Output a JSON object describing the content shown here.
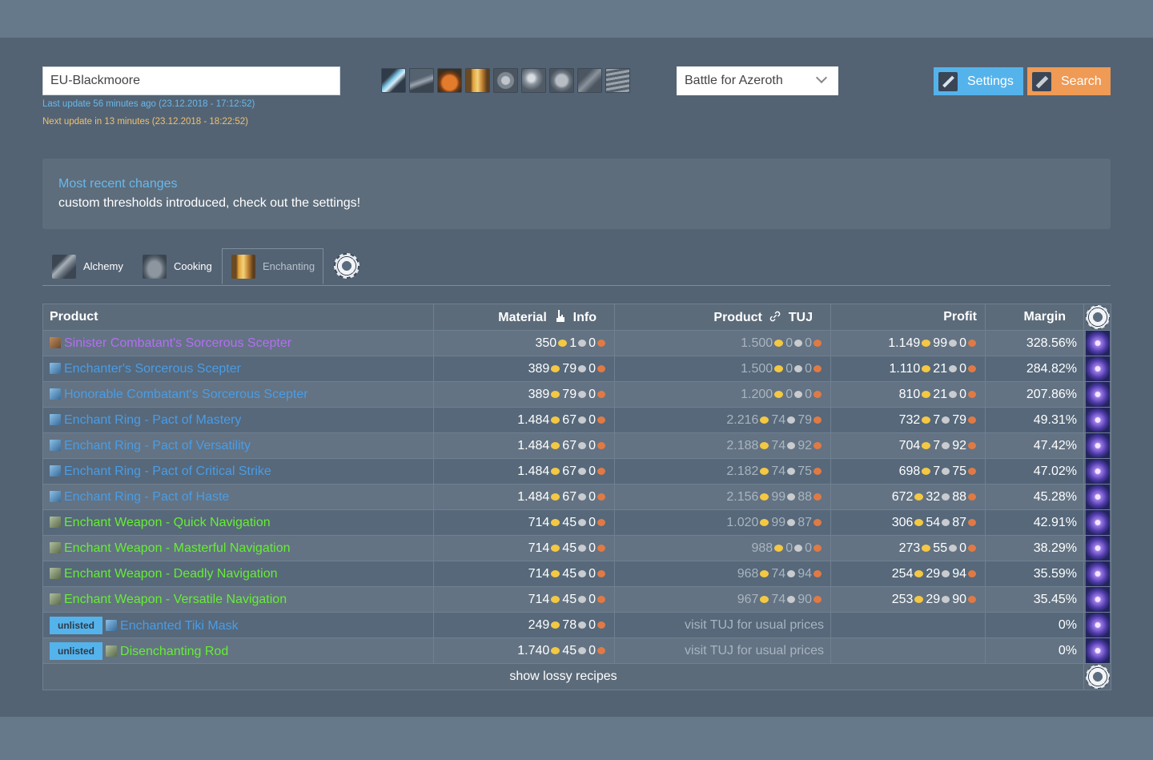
{
  "realm": {
    "value": "EU-Blackmoore"
  },
  "updates": {
    "last": "Last update 56 minutes ago (23.12.2018 - 17:12:52)",
    "next": "Next update in 13 minutes (23.12.2018 - 18:22:52)"
  },
  "profession_icons": [
    "alchemy-icon",
    "blacksmithing-icon",
    "cooking-icon",
    "enchanting-icon",
    "engineering-icon",
    "inscription-icon",
    "jewelcrafting-icon",
    "leatherworking-icon",
    "tailoring-icon"
  ],
  "expansion": {
    "selected": "Battle for Azeroth"
  },
  "buttons": {
    "settings": "Settings",
    "search": "Search"
  },
  "news": {
    "title": "Most recent changes",
    "text": "custom thresholds introduced, check out the settings!"
  },
  "tabs": [
    {
      "label": "Alchemy",
      "icon": "alchemy-tab-icon"
    },
    {
      "label": "Cooking",
      "icon": "cooking-tab-icon"
    },
    {
      "label": "Enchanting",
      "icon": "enchanting-tab-icon",
      "active": true
    }
  ],
  "table": {
    "headers": {
      "product": "Product",
      "material": "Material",
      "info": "Info",
      "product_tuj": "Product",
      "tuj": "TUJ",
      "profit": "Profit",
      "margin": "Margin"
    },
    "rows": [
      {
        "name": "Sinister Combatant's Sorcerous Scepter",
        "color": "purple",
        "unlisted": false,
        "mat": [
          "350",
          "1",
          "0"
        ],
        "prod": [
          "1.500",
          "0",
          "0"
        ],
        "profit": [
          "1.149",
          "99",
          "0"
        ],
        "margin": "328.56%"
      },
      {
        "name": "Enchanter's Sorcerous Scepter",
        "color": "blue",
        "unlisted": false,
        "mat": [
          "389",
          "79",
          "0"
        ],
        "prod": [
          "1.500",
          "0",
          "0"
        ],
        "profit": [
          "1.110",
          "21",
          "0"
        ],
        "margin": "284.82%"
      },
      {
        "name": "Honorable Combatant's Sorcerous Scepter",
        "color": "blue",
        "unlisted": false,
        "mat": [
          "389",
          "79",
          "0"
        ],
        "prod": [
          "1.200",
          "0",
          "0"
        ],
        "profit": [
          "810",
          "21",
          "0"
        ],
        "margin": "207.86%"
      },
      {
        "name": "Enchant Ring - Pact of Mastery",
        "color": "blue",
        "unlisted": false,
        "mat": [
          "1.484",
          "67",
          "0"
        ],
        "prod": [
          "2.216",
          "74",
          "79"
        ],
        "profit": [
          "732",
          "7",
          "79"
        ],
        "margin": "49.31%"
      },
      {
        "name": "Enchant Ring - Pact of Versatility",
        "color": "blue",
        "unlisted": false,
        "mat": [
          "1.484",
          "67",
          "0"
        ],
        "prod": [
          "2.188",
          "74",
          "92"
        ],
        "profit": [
          "704",
          "7",
          "92"
        ],
        "margin": "47.42%"
      },
      {
        "name": "Enchant Ring - Pact of Critical Strike",
        "color": "blue",
        "unlisted": false,
        "mat": [
          "1.484",
          "67",
          "0"
        ],
        "prod": [
          "2.182",
          "74",
          "75"
        ],
        "profit": [
          "698",
          "7",
          "75"
        ],
        "margin": "47.02%"
      },
      {
        "name": "Enchant Ring - Pact of Haste",
        "color": "blue",
        "unlisted": false,
        "mat": [
          "1.484",
          "67",
          "0"
        ],
        "prod": [
          "2.156",
          "99",
          "88"
        ],
        "profit": [
          "672",
          "32",
          "88"
        ],
        "margin": "45.28%"
      },
      {
        "name": "Enchant Weapon - Quick Navigation",
        "color": "green",
        "unlisted": false,
        "mat": [
          "714",
          "45",
          "0"
        ],
        "prod": [
          "1.020",
          "99",
          "87"
        ],
        "profit": [
          "306",
          "54",
          "87"
        ],
        "margin": "42.91%"
      },
      {
        "name": "Enchant Weapon - Masterful Navigation",
        "color": "green",
        "unlisted": false,
        "mat": [
          "714",
          "45",
          "0"
        ],
        "prod": [
          "988",
          "0",
          "0"
        ],
        "profit": [
          "273",
          "55",
          "0"
        ],
        "margin": "38.29%"
      },
      {
        "name": "Enchant Weapon - Deadly Navigation",
        "color": "green",
        "unlisted": false,
        "mat": [
          "714",
          "45",
          "0"
        ],
        "prod": [
          "968",
          "74",
          "94"
        ],
        "profit": [
          "254",
          "29",
          "94"
        ],
        "margin": "35.59%"
      },
      {
        "name": "Enchant Weapon - Versatile Navigation",
        "color": "green",
        "unlisted": false,
        "mat": [
          "714",
          "45",
          "0"
        ],
        "prod": [
          "967",
          "74",
          "90"
        ],
        "profit": [
          "253",
          "29",
          "90"
        ],
        "margin": "35.45%"
      },
      {
        "name": "Enchanted Tiki Mask",
        "color": "blue",
        "unlisted": true,
        "mat": [
          "249",
          "78",
          "0"
        ],
        "prod_text": "visit TUJ for usual prices",
        "margin": "0%"
      },
      {
        "name": "Disenchanting Rod",
        "color": "green",
        "unlisted": true,
        "mat": [
          "1.740",
          "45",
          "0"
        ],
        "prod_text": "visit TUJ for usual prices",
        "margin": "0%"
      }
    ],
    "unlisted_label": "unlisted",
    "footer": "show lossy recipes"
  },
  "colors": {
    "purple": "#b46ef5",
    "blue": "#4a9ce6",
    "green": "#66ee33",
    "settings": "#55b3ec",
    "search": "#ef9a55",
    "background": "#536373"
  }
}
